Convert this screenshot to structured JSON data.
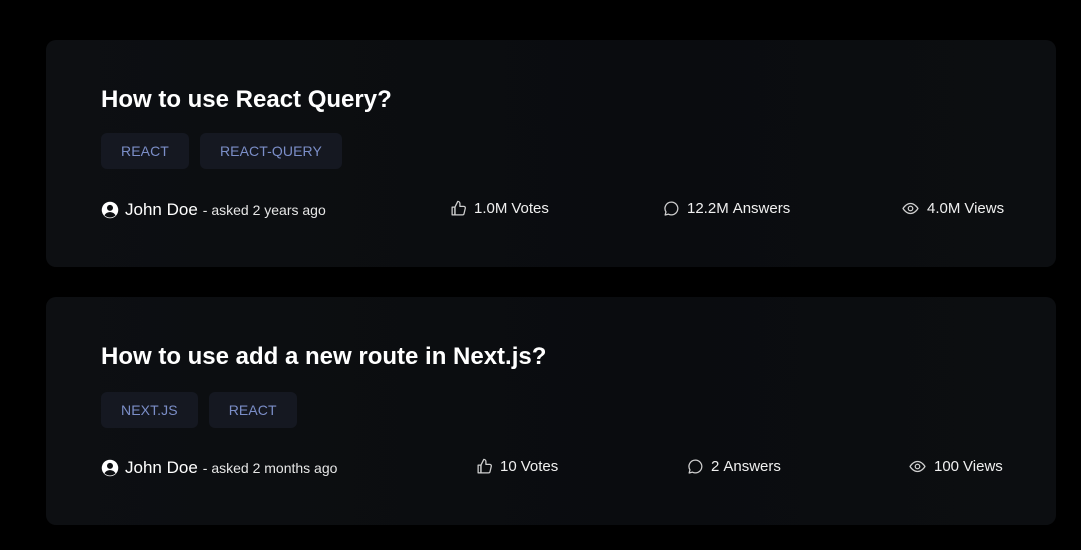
{
  "questions": [
    {
      "title": "How to use React Query?",
      "tags": [
        "REACT",
        "REACT-QUERY"
      ],
      "author": "John Doe",
      "asked": "- asked 2 years ago",
      "votes": "1.0M",
      "votes_label": "Votes",
      "answers": "12.2M",
      "answers_label": "Answers",
      "views": "4.0M",
      "views_label": "Views"
    },
    {
      "title": "How to use add a new route in Next.js?",
      "tags": [
        "NEXT.JS",
        "REACT"
      ],
      "author": "John Doe",
      "asked": "- asked 2 months ago",
      "votes": "10",
      "votes_label": "Votes",
      "answers": "2",
      "answers_label": "Answers",
      "views": "100",
      "views_label": "Views"
    }
  ],
  "icons": {
    "author": "user-circle-icon",
    "votes": "thumbs-up-icon",
    "answers": "message-circle-icon",
    "views": "eye-icon"
  },
  "colors": {
    "background": "#000000",
    "card": "#0d0f12",
    "tag_bg": "#151821",
    "tag_text": "#7b8ec8",
    "text": "#ffffff"
  }
}
